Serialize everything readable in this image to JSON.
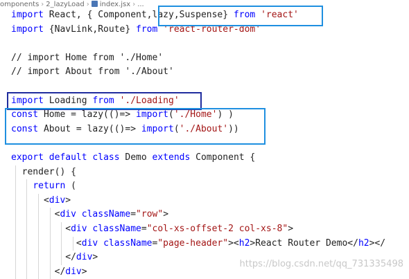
{
  "breadcrumb": {
    "items": [
      "omponents",
      "2_lazyLoad",
      "index.jsx",
      "..."
    ]
  },
  "colors": {
    "keyword": "#0000ff",
    "string": "#a31515",
    "text": "#222222",
    "highlight_box_blue": "#1e8fe0",
    "highlight_box_navy": "#1f2c9e"
  },
  "code_lines": [
    [
      [
        "kw",
        "import"
      ],
      [
        "p",
        " React, { Component,"
      ],
      [
        "p",
        "lazy,Suspense"
      ],
      [
        "p",
        "} "
      ],
      [
        "kw",
        "from"
      ],
      [
        "p",
        " "
      ],
      [
        "str",
        "'react'"
      ]
    ],
    [
      [
        "kw",
        "import"
      ],
      [
        "p",
        " {NavLink,Route} "
      ],
      [
        "kw",
        "from"
      ],
      [
        "p",
        " "
      ],
      [
        "str",
        "'react-router-dom'"
      ]
    ],
    [],
    [
      [
        "p",
        "// import Home from './Home'"
      ]
    ],
    [
      [
        "p",
        "// import About from './About'"
      ]
    ],
    [],
    [
      [
        "kw",
        "import"
      ],
      [
        "p",
        " Loading "
      ],
      [
        "kw",
        "from"
      ],
      [
        "p",
        " "
      ],
      [
        "str",
        "'./Loading'"
      ]
    ],
    [
      [
        "kw",
        "const"
      ],
      [
        "p",
        " Home = lazy(()=> "
      ],
      [
        "kw",
        "import"
      ],
      [
        "p",
        "("
      ],
      [
        "str",
        "'./Home'"
      ],
      [
        "p",
        ") )"
      ]
    ],
    [
      [
        "kw",
        "const"
      ],
      [
        "p",
        " About = lazy(()=> "
      ],
      [
        "kw",
        "import"
      ],
      [
        "p",
        "("
      ],
      [
        "str",
        "'./About'"
      ],
      [
        "p",
        "))"
      ]
    ],
    [],
    [
      [
        "kw",
        "export"
      ],
      [
        "p",
        " "
      ],
      [
        "kw",
        "default"
      ],
      [
        "p",
        " "
      ],
      [
        "kw",
        "class"
      ],
      [
        "p",
        " Demo "
      ],
      [
        "kw",
        "extends"
      ],
      [
        "p",
        " Component {"
      ]
    ],
    [
      [
        "p",
        "  render() {"
      ]
    ],
    [
      [
        "p",
        "    "
      ],
      [
        "kw",
        "return"
      ],
      [
        "p",
        " ("
      ]
    ],
    [
      [
        "p",
        "      <"
      ],
      [
        "kw",
        "div"
      ],
      [
        "p",
        ">"
      ]
    ],
    [
      [
        "p",
        "        <"
      ],
      [
        "kw",
        "div"
      ],
      [
        "p",
        " "
      ],
      [
        "kw",
        "className"
      ],
      [
        "p",
        "="
      ],
      [
        "str",
        "\"row\""
      ],
      [
        "p",
        ">"
      ]
    ],
    [
      [
        "p",
        "          <"
      ],
      [
        "kw",
        "div"
      ],
      [
        "p",
        " "
      ],
      [
        "kw",
        "className"
      ],
      [
        "p",
        "="
      ],
      [
        "str",
        "\"col-xs-offset-2 col-xs-8\""
      ],
      [
        "p",
        ">"
      ]
    ],
    [
      [
        "p",
        "            <"
      ],
      [
        "kw",
        "div"
      ],
      [
        "p",
        " "
      ],
      [
        "kw",
        "className"
      ],
      [
        "p",
        "="
      ],
      [
        "str",
        "\"page-header\""
      ],
      [
        "p",
        "><"
      ],
      [
        "kw",
        "h2"
      ],
      [
        "p",
        ">React Router Demo</"
      ],
      [
        "kw",
        "h2"
      ],
      [
        "p",
        "></"
      ]
    ],
    [
      [
        "p",
        "          </"
      ],
      [
        "kw",
        "div"
      ],
      [
        "p",
        ">"
      ]
    ],
    [
      [
        "p",
        "        </"
      ],
      [
        "kw",
        "div"
      ],
      [
        "p",
        ">"
      ]
    ]
  ],
  "watermark": "https://blog.csdn.net/qq_731335498"
}
